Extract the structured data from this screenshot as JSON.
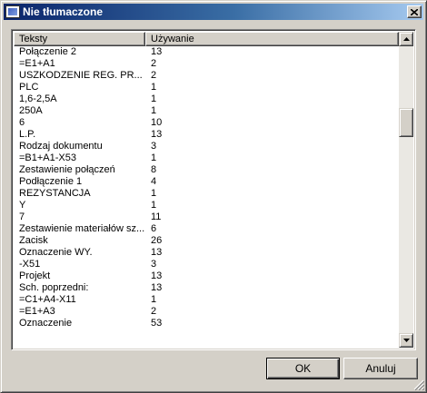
{
  "window": {
    "title": "Nie tłumaczone"
  },
  "list": {
    "columns": [
      "Teksty",
      "Używanie"
    ],
    "rows": [
      {
        "text": "Połączenie 2",
        "usage": "13"
      },
      {
        "text": "=E1+A1",
        "usage": "2"
      },
      {
        "text": "USZKODZENIE REG. PR...",
        "usage": "2"
      },
      {
        "text": "PLC",
        "usage": "1"
      },
      {
        "text": "1,6-2,5A",
        "usage": "1"
      },
      {
        "text": "250A",
        "usage": "1"
      },
      {
        "text": "6",
        "usage": "10"
      },
      {
        "text": "L.P.",
        "usage": "13"
      },
      {
        "text": "Rodzaj dokumentu",
        "usage": "3"
      },
      {
        "text": "=B1+A1-X53",
        "usage": "1"
      },
      {
        "text": "Zestawienie połączeń",
        "usage": "8"
      },
      {
        "text": "Podłączenie 1",
        "usage": "4"
      },
      {
        "text": "REZYSTANCJA",
        "usage": "1"
      },
      {
        "text": "Y",
        "usage": "1"
      },
      {
        "text": "7",
        "usage": "11"
      },
      {
        "text": "Zestawienie materiałów sz...",
        "usage": "6"
      },
      {
        "text": "Zacisk",
        "usage": "26"
      },
      {
        "text": "Oznaczenie WY.",
        "usage": "13"
      },
      {
        "text": "-X51",
        "usage": "3"
      },
      {
        "text": "Projekt",
        "usage": "13"
      },
      {
        "text": "Sch. poprzedni:",
        "usage": "13"
      },
      {
        "text": "=C1+A4-X11",
        "usage": "1"
      },
      {
        "text": "=E1+A3",
        "usage": "2"
      },
      {
        "text": "Oznaczenie",
        "usage": "53"
      }
    ]
  },
  "buttons": {
    "ok": "OK",
    "cancel": "Anuluj"
  },
  "icons": {
    "app": "app-icon",
    "close": "close-icon",
    "scroll_up": "arrow-up-icon",
    "scroll_down": "arrow-down-icon",
    "grip": "resize-grip-icon"
  },
  "colors": {
    "title_start": "#0a246a",
    "title_end": "#a6caf0",
    "face": "#d4d0c8"
  }
}
